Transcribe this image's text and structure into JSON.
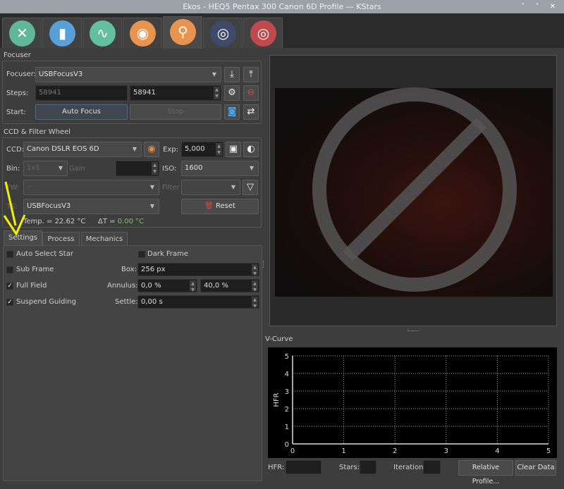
{
  "window": {
    "title": "Ekos - HEQ5 Pentax 300 Canon 6D Profile — KStars",
    "controls": "˅ ˄ ✕"
  },
  "module_tabs": [
    {
      "name": "setup",
      "color": "#5fb89a",
      "glyph": "✕"
    },
    {
      "name": "scheduler",
      "color": "#5aa0d8",
      "glyph": "▮"
    },
    {
      "name": "analyze",
      "color": "#62bfa0",
      "glyph": "∿"
    },
    {
      "name": "capture",
      "color": "#e89450",
      "glyph": "◉"
    },
    {
      "name": "focus",
      "color": "#e89450",
      "glyph": "⚲",
      "active": true
    },
    {
      "name": "align",
      "color": "#3f4a6a",
      "glyph": "◎"
    },
    {
      "name": "guide",
      "color": "#c0494d",
      "glyph": "◎"
    }
  ],
  "focuser": {
    "group_title": "Focuser",
    "focuser_label": "Focuser:",
    "focuser_value": "USBFocusV3",
    "steps_label": "Steps:",
    "steps_current": "58941",
    "steps_target": "58941",
    "start_label": "Start:",
    "auto_focus": "Auto Focus",
    "stop": "Stop"
  },
  "ccd": {
    "group_title": "CCD & Filter Wheel",
    "ccd_label": "CCD:",
    "ccd_value": "Canon DSLR EOS 6D",
    "exp_label": "Exp:",
    "exp_value": "5,000",
    "bin_label": "Bin:",
    "bin_value": "1x1",
    "gain_label": "Gain",
    "iso_label": "ISO:",
    "iso_value": "1600",
    "fw_label": "FW:",
    "fw_value": "--",
    "filter_label": "Filter",
    "ts_label": "TS:",
    "ts_value": "USBFocusV3",
    "reset": "Reset",
    "temp": "Temp. = 22.62 °C",
    "delta_label": "ΔT = ",
    "delta_value": "0.00 °C",
    "delta_color": "#7fbf6a"
  },
  "settings_tabs": [
    "Settings",
    "Process",
    "Mechanics"
  ],
  "settings": {
    "auto_select_star": {
      "label": "Auto Select Star",
      "checked": false
    },
    "dark_frame": {
      "label": "Dark Frame",
      "checked": false
    },
    "sub_frame": {
      "label": "Sub Frame",
      "checked": false
    },
    "full_field": {
      "label": "Full Field",
      "checked": true
    },
    "suspend_guiding": {
      "label": "Suspend Guiding",
      "checked": true
    },
    "box_label": "Box:",
    "box_value": "256 px",
    "annulus_label": "Annulus:",
    "annulus_min": "0,0 %",
    "annulus_max": "40,0 %",
    "settle_label": "Settle:",
    "settle_value": "0,00 s"
  },
  "vcurve": {
    "title": "V-Curve",
    "hfr_label": "HFR:",
    "stars_label": "Stars:",
    "iteration_label": "Iteration:",
    "relative_profile": "Relative Profile...",
    "clear_data": "Clear Data"
  },
  "chart_data": {
    "type": "line",
    "title": "",
    "xlabel": "",
    "ylabel": "HFR",
    "xlim": [
      0,
      5
    ],
    "ylim": [
      0,
      5
    ],
    "xticks": [
      "0",
      "1",
      "2",
      "3",
      "4",
      "5"
    ],
    "yticks": [
      "0",
      "1",
      "2",
      "3",
      "4",
      "5"
    ],
    "grid": true,
    "series": []
  }
}
